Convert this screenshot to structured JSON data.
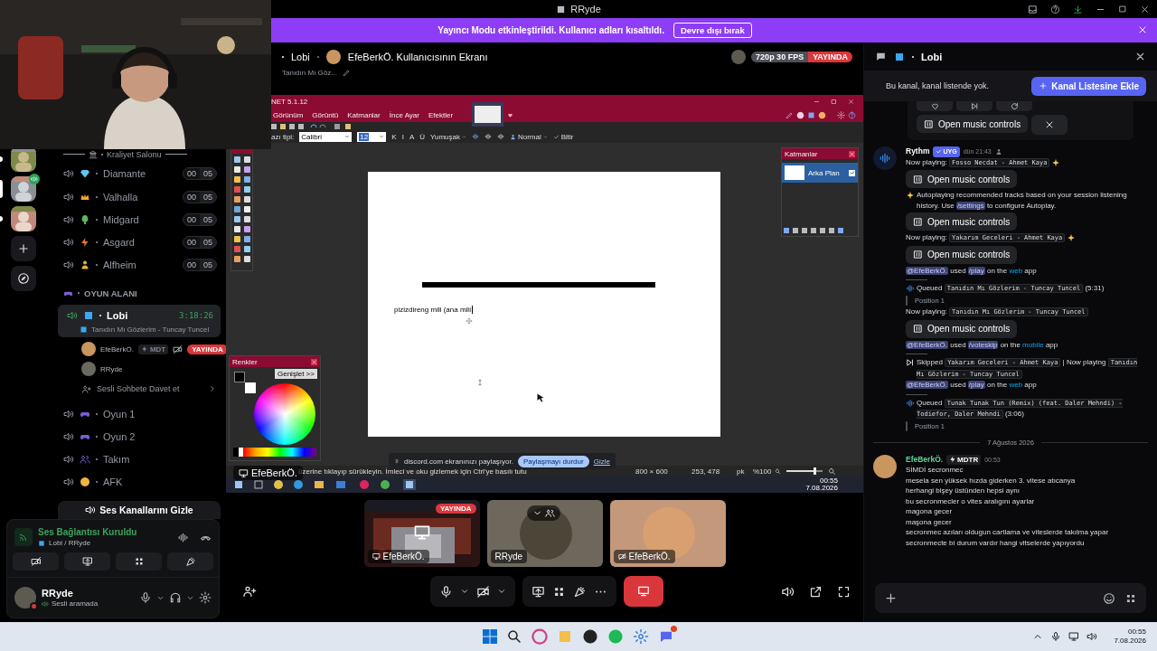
{
  "title_bar": {
    "title": "RRyde"
  },
  "banner": {
    "text": "Yayıncı Modu etkinleştirildi. Kullanıcı adları kısaltıldı.",
    "button": "Devre dışı bırak"
  },
  "servers": [
    {
      "selected": false,
      "unread": true,
      "voice": false
    },
    {
      "selected": true,
      "unread": false,
      "voice": true
    },
    {
      "selected": false,
      "unread": true,
      "voice": false
    }
  ],
  "sidebar": {
    "section": "Kraliyet Salonu",
    "channels": [
      {
        "name": "Diamante",
        "kind": "diamond",
        "count": "00",
        "limit": "05"
      },
      {
        "name": "Valhalla",
        "kind": "crown",
        "count": "00",
        "limit": "05"
      },
      {
        "name": "Midgard",
        "kind": "tree",
        "count": "00",
        "limit": "05"
      },
      {
        "name": "Asgard",
        "kind": "bolt",
        "count": "00",
        "limit": "05"
      },
      {
        "name": "Alfheim",
        "kind": "figure",
        "count": "00",
        "limit": "05"
      }
    ],
    "category": "OYUN ALANI",
    "active_channel": {
      "name": "Lobi",
      "timer": "3:18:26",
      "activity": "Tanıdın Mı Gözlerim - Tuncay Tuncel",
      "members": [
        {
          "name": "EfeBerkÖ.",
          "tag": "MDT",
          "camera_off": true,
          "live": true,
          "live_label": "YAYINDA"
        },
        {
          "name": "RRyde",
          "camera_off": false,
          "live": false
        }
      ],
      "invite": "Sesli Sohbete Davet et"
    },
    "more_channels": [
      {
        "name": "Oyun 1",
        "kind": "gamepad"
      },
      {
        "name": "Oyun 2",
        "kind": "gamepad"
      },
      {
        "name": "Takım",
        "kind": "people"
      },
      {
        "name": "AFK",
        "kind": "sleep"
      }
    ],
    "hide_button": "Ses Kanallarını Gizle"
  },
  "voice_panel": {
    "status": "Ses Bağlantısı Kuruldu",
    "channel": "Lobi / RRyde",
    "camera_on": false
  },
  "user": {
    "name": "RRyde",
    "status": "Sesli aramada",
    "dnd": true
  },
  "stage": {
    "channel": "Lobi",
    "title": "EfeBerkÖ. Kullanıcısının Ekranı",
    "activity": "Tanıdın Mı Göz...",
    "quality": "720p 30 FPS",
    "badge": "YAYINDA"
  },
  "shared_screen": {
    "app_title": "NET 5.1.12",
    "menus": [
      "Görünüm",
      "Görüntü",
      "Katmanlar",
      "İnce Ayar",
      "Efektler"
    ],
    "font_label": "azı tipi:",
    "font": "Calibri",
    "size": "12",
    "format_buttons": [
      "K",
      "I",
      "A",
      "Ü"
    ],
    "antialias": "Yumuşak",
    "blend": "Normal",
    "finish": "Bitir",
    "layers_title": "Katmanlar",
    "layers": [
      {
        "name": "Arka Plan",
        "visible": true,
        "selected": true
      }
    ],
    "colors_title": "Renkler",
    "expand": "Genişlet >>",
    "canvas_text": "pizizdireng mili (ana mili",
    "hint": "üzerine tıklayıp sürükleyin. İmleci ve oku gizlemek için Ctrl'ye basılı tutu",
    "image_size": "800 × 600",
    "cursor_pos": "253, 478",
    "unit": "pk",
    "zoom": "%100",
    "zoom_slider": {
      "level": 0.78
    },
    "share_notice": "discord.com ekranınızı paylaşıyor.",
    "stop_share": "Paylaşmayı durdur",
    "hide": "Gizle",
    "clock": "00:55",
    "date": "7.08.2026",
    "presenter": "EfeBerkÖ."
  },
  "tiles": [
    {
      "kind": "screen",
      "name": "EfeBerkÖ.",
      "badge": "YAYINDA",
      "camera_off": false,
      "hovered": false
    },
    {
      "kind": "avatar",
      "name": "RRyde",
      "camera_off": false,
      "hovered": true
    },
    {
      "kind": "avatar",
      "name": "EfeBerkÖ.",
      "camera_off": true,
      "hovered": false
    }
  ],
  "controls": {
    "mic_on": true,
    "camera_on": false
  },
  "chat": {
    "channel": "Lobi",
    "notice": "Bu kanal, kanal listende yok.",
    "notice_button": "Kanal Listesine Ekle",
    "feed": [
      {
        "kind": "embed",
        "button": "Open music controls"
      },
      {
        "kind": "message",
        "author": "Rythm",
        "bot": true,
        "badge": "UYG",
        "time": "dün 21:43",
        "lines": [
          {
            "kind": "text",
            "sparkle_end": true,
            "parts": [
              {
                "kind": "plain",
                "text": "Now playing: "
              },
              {
                "kind": "code",
                "text": "Fosso Necdat - Ahmet Kaya"
              }
            ]
          },
          {
            "kind": "button",
            "text": "Open music controls"
          },
          {
            "kind": "text",
            "sparkle_start": true,
            "parts": [
              {
                "kind": "plain",
                "text": " Autoplaying recommended tracks based on your session listening history. Use "
              },
              {
                "kind": "command",
                "text": "/settings"
              },
              {
                "kind": "plain",
                "text": " to configure Autoplay."
              }
            ]
          },
          {
            "kind": "button",
            "text": "Open music controls"
          },
          {
            "kind": "text",
            "sparkle_end": true,
            "parts": [
              {
                "kind": "plain",
                "text": "Now playing: "
              },
              {
                "kind": "code",
                "text": "Yakarım Geceleri - Ahmet Kaya"
              }
            ]
          },
          {
            "kind": "button",
            "text": "Open music controls"
          },
          {
            "kind": "command",
            "parts": [
              {
                "kind": "mention",
                "text": "@EfeBerkÖ."
              },
              {
                "kind": "plain",
                "text": " used "
              },
              {
                "kind": "command",
                "text": "/play"
              },
              {
                "kind": "plain",
                "text": " on the "
              },
              {
                "kind": "link",
                "text": "web"
              },
              {
                "kind": "plain",
                "text": " app"
              }
            ]
          },
          {
            "kind": "queued",
            "parts": [
              {
                "kind": "plain",
                "text": "Queued "
              },
              {
                "kind": "code",
                "text": "Tanıdın Mı Gözlerim - Tuncay Tuncel"
              },
              {
                "kind": "plain",
                "text": " (5:31)"
              }
            ]
          },
          {
            "kind": "quote",
            "text": "Position 1"
          },
          {
            "kind": "text",
            "parts": [
              {
                "kind": "plain",
                "text": "Now playing: "
              },
              {
                "kind": "code",
                "text": "Tanıdın Mı Gözlerim - Tuncay Tuncel"
              }
            ]
          },
          {
            "kind": "button",
            "text": "Open music controls"
          },
          {
            "kind": "command",
            "parts": [
              {
                "kind": "mention",
                "text": "@EfeBerkÖ."
              },
              {
                "kind": "plain",
                "text": " used "
              },
              {
                "kind": "command",
                "text": "/voteskip"
              },
              {
                "kind": "plain",
                "text": " on the "
              },
              {
                "kind": "link",
                "text": "mobile"
              },
              {
                "kind": "plain",
                "text": " app"
              }
            ]
          },
          {
            "kind": "skipped",
            "parts": [
              {
                "kind": "plain",
                "text": "Skipped "
              },
              {
                "kind": "code",
                "text": "Yakarım Geceleri - Ahmet Kaya"
              },
              {
                "kind": "plain",
                "text": " | Now playing "
              },
              {
                "kind": "code",
                "text": "Tanıdın Mı Gözlerim - Tuncay Tuncel"
              }
            ]
          },
          {
            "kind": "command",
            "parts": [
              {
                "kind": "mention",
                "text": "@EfeBerkÖ."
              },
              {
                "kind": "plain",
                "text": " used "
              },
              {
                "kind": "command",
                "text": "/play"
              },
              {
                "kind": "plain",
                "text": " on the "
              },
              {
                "kind": "link",
                "text": "web"
              },
              {
                "kind": "plain",
                "text": " app"
              }
            ]
          },
          {
            "kind": "queued",
            "parts": [
              {
                "kind": "plain",
                "text": "Queued "
              },
              {
                "kind": "code",
                "text": "Tunak Tunak Tun (Remix) (feat. Daler Mehndi) - Todiefor, Daler Mehndi"
              },
              {
                "kind": "plain",
                "text": " (3:06)"
              }
            ]
          },
          {
            "kind": "quote",
            "text": "Position 1"
          }
        ]
      },
      {
        "kind": "divider",
        "text": "7 Ağustos 2026"
      },
      {
        "kind": "message",
        "author": "EfeBerkÖ.",
        "bot": false,
        "tag": "MDTR",
        "time": "00:53",
        "lines": [
          {
            "kind": "text",
            "parts": [
              {
                "kind": "plain",
                "text": "SİMDİ secronmec"
              }
            ]
          },
          {
            "kind": "text",
            "parts": [
              {
                "kind": "plain",
                "text": "mesela sen yüksek hızda giderken 3. vitese atıcanya"
              }
            ]
          },
          {
            "kind": "text",
            "parts": [
              {
                "kind": "plain",
                "text": "herhangi bişey üstünden hepsi aynı"
              }
            ]
          },
          {
            "kind": "text",
            "parts": [
              {
                "kind": "plain",
                "text": "bu secronmecler o vites aralıgını ayarlar"
              }
            ]
          },
          {
            "kind": "text",
            "parts": [
              {
                "kind": "plain",
                "text": "magona gecer"
              }
            ]
          },
          {
            "kind": "text",
            "parts": [
              {
                "kind": "plain",
                "text": "maşona gecer"
              }
            ]
          },
          {
            "kind": "text",
            "parts": [
              {
                "kind": "plain",
                "text": "secronmec azıları oldugun cartlama ve viteslerde takılma yapar"
              }
            ]
          },
          {
            "kind": "text",
            "parts": [
              {
                "kind": "plain",
                "text": "secronmecte bi durum vardır hangi vitselerde yapıyordu"
              }
            ]
          }
        ]
      }
    ]
  },
  "os_taskbar": {
    "time": "00:55",
    "date": "7.08.2026",
    "badge": true
  }
}
